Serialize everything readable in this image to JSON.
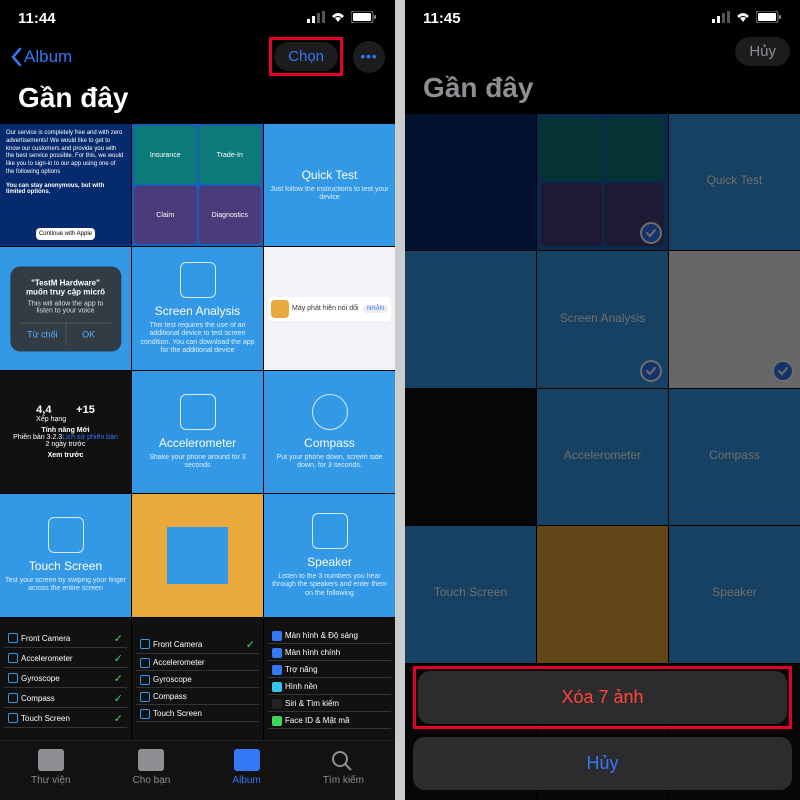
{
  "left": {
    "time": "11:44",
    "back_label": "Album",
    "select_label": "Chọn",
    "title": "Gần đây",
    "thumbs": {
      "quicktest": {
        "title": "Quick Test",
        "sub": "Just follow the instructions to test your device"
      },
      "screen": {
        "title": "Screen Analysis",
        "sub": "This test requires the use of an additional device to test screen condition. You can download the app for the additional device"
      },
      "accel": {
        "title": "Accelerometer",
        "sub": "Shake your phone around for 3 seconds"
      },
      "compass": {
        "title": "Compass",
        "sub": "Put your phone down, screen side down, for 3 seconds."
      },
      "touch": {
        "title": "Touch Screen",
        "sub": "Test your screen by swiping your finger across the entire screen"
      },
      "speaker": {
        "title": "Speaker",
        "sub": "Listen to the 3 numbers you hear through the speakers and enter them on the following"
      },
      "promo_line1": "Our service is completely free and with zero advertisements! We would like to get to know our customers and provide you with the best service possible. For this, we would like you to sign-in to our app using one of the following options",
      "promo_line2": "You can stay anonymous, but with limited options.",
      "promo_btn": "Continue with Apple",
      "cards": {
        "insurance": "Insurance",
        "tradein": "Trade-In",
        "claim": "Claim",
        "diag": "Diagnostics"
      },
      "dialog": {
        "title": "\"TestM Hardware\" muốn truy cập micrô",
        "sub": "This will allow the app to listen to your voice",
        "deny": "Từ chối",
        "ok": "OK"
      },
      "appstore": {
        "rating": "4,4",
        "label": "Xếp hạng",
        "age": "+15",
        "new": "Tính năng Mới",
        "ver": "Phiên bản 3.2.3",
        "preview": "Xem trước",
        "history": "Lịch sử phiên bản",
        "days": "2 ngày trước"
      },
      "applist": {
        "app1": "Máy phát hiện nói dối",
        "tag": "NHẬN"
      },
      "sensors": [
        "Front Camera",
        "Accelerometer",
        "Gyroscope",
        "Compass",
        "Touch Screen"
      ],
      "settings": [
        "Màn hình & Độ sáng",
        "Màn hình chính",
        "Trợ năng",
        "Hình nền",
        "Siri & Tìm kiếm",
        "Face ID & Mật mã"
      ]
    },
    "tabs": {
      "library": "Thư viện",
      "foryou": "Cho bạn",
      "album": "Album",
      "search": "Tìm kiếm"
    }
  },
  "right": {
    "time": "11:45",
    "cancel_label": "Hủy",
    "title": "Gần đây",
    "delete_label": "Xóa 7 ảnh",
    "sheet_cancel": "Hủy"
  }
}
